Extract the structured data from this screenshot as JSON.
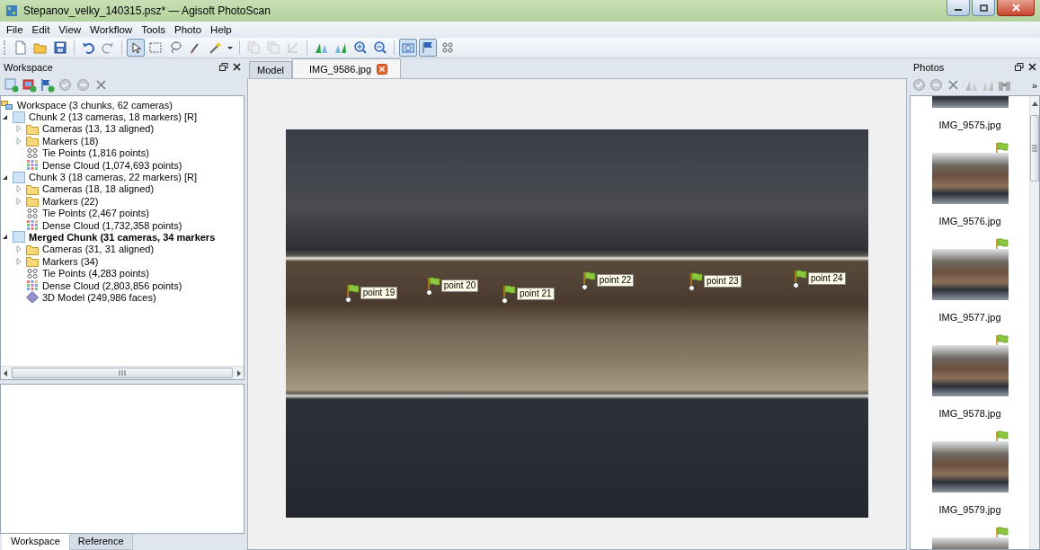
{
  "window": {
    "title": "Stepanov_velky_140315.psz* — Agisoft PhotoScan"
  },
  "menu": [
    "File",
    "Edit",
    "View",
    "Workflow",
    "Tools",
    "Photo",
    "Help"
  ],
  "toolbar": [
    {
      "kind": "new",
      "pressed": false,
      "disabled": false
    },
    {
      "kind": "open",
      "pressed": false,
      "disabled": false
    },
    {
      "kind": "save",
      "pressed": false,
      "disabled": false
    },
    {
      "kind": "separator"
    },
    {
      "kind": "undo",
      "pressed": false,
      "disabled": false
    },
    {
      "kind": "redo",
      "pressed": false,
      "disabled": false
    },
    {
      "kind": "separator"
    },
    {
      "kind": "pointer",
      "pressed": true,
      "disabled": false
    },
    {
      "kind": "rect-select",
      "pressed": false,
      "disabled": false
    },
    {
      "kind": "lasso",
      "pressed": false,
      "disabled": false
    },
    {
      "kind": "brush",
      "pressed": false,
      "disabled": false
    },
    {
      "kind": "wand",
      "pressed": false,
      "disabled": false
    },
    {
      "kind": "caret",
      "pressed": false,
      "disabled": false
    },
    {
      "kind": "separator"
    },
    {
      "kind": "copy",
      "pressed": false,
      "disabled": true
    },
    {
      "kind": "copy",
      "pressed": false,
      "disabled": true
    },
    {
      "kind": "crop",
      "pressed": false,
      "disabled": true
    },
    {
      "kind": "separator"
    },
    {
      "kind": "align-left",
      "pressed": false,
      "disabled": false
    },
    {
      "kind": "align-right",
      "pressed": false,
      "disabled": false
    },
    {
      "kind": "zoom-in",
      "pressed": false,
      "disabled": false
    },
    {
      "kind": "zoom-out",
      "pressed": false,
      "disabled": false
    },
    {
      "kind": "separator"
    },
    {
      "kind": "camera",
      "pressed": true,
      "disabled": false
    },
    {
      "kind": "flag",
      "pressed": true,
      "disabled": false
    },
    {
      "kind": "dots",
      "pressed": false,
      "disabled": false
    }
  ],
  "workspace_panel": {
    "title": "Workspace",
    "tree": {
      "label": "Workspace (3 chunks, 62 cameras)",
      "kind": "workspace",
      "children": [
        {
          "label": "Chunk 2 (13 cameras, 18 markers) [R]",
          "kind": "chunk",
          "expanded": true,
          "active": false,
          "children": [
            {
              "label": "Cameras (13, 13 aligned)",
              "kind": "folder",
              "expanded": false
            },
            {
              "label": "Markers (18)",
              "kind": "folder",
              "expanded": false
            },
            {
              "label": "Tie Points (1,816 points)",
              "kind": "tie-points"
            },
            {
              "label": "Dense Cloud (1,074,693 points)",
              "kind": "dense-cloud"
            }
          ]
        },
        {
          "label": "Chunk 3 (18 cameras, 22 markers) [R]",
          "kind": "chunk",
          "expanded": true,
          "active": false,
          "children": [
            {
              "label": "Cameras (18, 18 aligned)",
              "kind": "folder",
              "expanded": false
            },
            {
              "label": "Markers (22)",
              "kind": "folder",
              "expanded": false
            },
            {
              "label": "Tie Points (2,467 points)",
              "kind": "tie-points"
            },
            {
              "label": "Dense Cloud (1,732,358 points)",
              "kind": "dense-cloud"
            }
          ]
        },
        {
          "label": "Merged Chunk (31 cameras, 34 markers",
          "kind": "chunk",
          "expanded": true,
          "active": true,
          "children": [
            {
              "label": "Cameras (31, 31 aligned)",
              "kind": "folder",
              "expanded": false
            },
            {
              "label": "Markers (34)",
              "kind": "folder",
              "expanded": false
            },
            {
              "label": "Tie Points (4,283 points)",
              "kind": "tie-points"
            },
            {
              "label": "Dense Cloud (2,803,856 points)",
              "kind": "dense-cloud"
            },
            {
              "label": "3D Model (249,986 faces)",
              "kind": "model"
            }
          ]
        }
      ]
    },
    "tabs": [
      {
        "label": "Workspace",
        "selected": true
      },
      {
        "label": "Reference",
        "selected": false
      }
    ]
  },
  "viewer": {
    "tabs": [
      {
        "label": "Model",
        "selected": false
      },
      {
        "label": "IMG_9586.jpg",
        "selected": true
      }
    ],
    "markers": [
      {
        "label": "point 19"
      },
      {
        "label": "point 20"
      },
      {
        "label": "point 21"
      },
      {
        "label": "point 22"
      },
      {
        "label": "point 23"
      },
      {
        "label": "point 24"
      }
    ]
  },
  "photos_panel": {
    "title": "Photos",
    "more": "»",
    "photos": [
      {
        "name": "IMG_9575.jpg"
      },
      {
        "name": "IMG_9576.jpg",
        "flagged": true
      },
      {
        "name": "IMG_9577.jpg",
        "flagged": true
      },
      {
        "name": "IMG_9578.jpg",
        "flagged": true
      },
      {
        "name": "IMG_9579.jpg",
        "flagged": true
      },
      {
        "flagged": true
      }
    ]
  }
}
